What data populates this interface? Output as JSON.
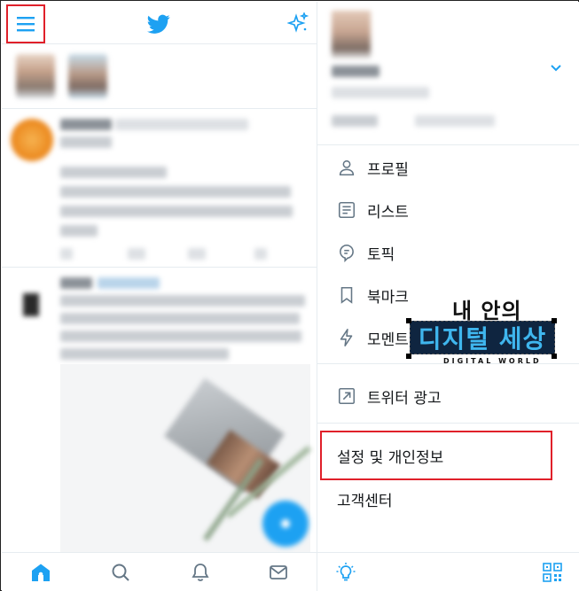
{
  "drawer": {
    "menu": {
      "profile": "프로필",
      "lists": "리스트",
      "topics": "토픽",
      "bookmarks": "북마크",
      "moments": "모멘트",
      "ads": "트위터 광고"
    },
    "settings": "설정 및 개인정보",
    "help": "고객센터"
  },
  "watermark": {
    "line1": "내 안의",
    "line2": "디지털 세상",
    "line3": "DIGITAL WORLD"
  },
  "colors": {
    "accent": "#1da1f2",
    "highlight": "#e0202a"
  }
}
